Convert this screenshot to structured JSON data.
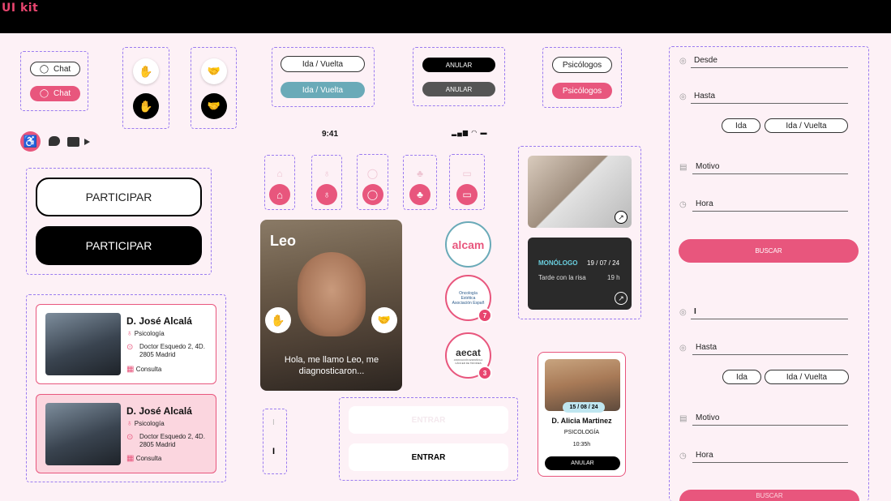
{
  "header": {
    "title": "UI kit"
  },
  "chat": {
    "label_outline": "Chat",
    "label_filled": "Chat"
  },
  "trip": {
    "label_outline": "Ida / Vuelta",
    "label_teal": "Ida / Vuelta"
  },
  "cancel": {
    "label_black": "ANULAR",
    "label_gray": "ANULAR"
  },
  "psych": {
    "label_outline": "Psicólogos",
    "label_pink": "Psicólogos"
  },
  "status_bar": {
    "time": "9:41"
  },
  "participate": {
    "label_outline": "PARTICIPAR",
    "label_black": "PARTICIPAR"
  },
  "profile_card": {
    "name": "Leo",
    "message": "Hola, me llamo Leo, me diagnosticaron..."
  },
  "doctors": [
    {
      "name": "D. José Alcalá",
      "specialty": "Psicología",
      "address_line1": "Doctor Esquedo 2, 4D.",
      "address_line2": "2805 Madrid",
      "action": "Consulta"
    },
    {
      "name": "D. José Alcalá",
      "specialty": "Psicología",
      "address_line1": "Doctor Esquedo 2, 4D.",
      "address_line2": "2805 Madrid",
      "action": "Consulta"
    }
  ],
  "associations": [
    {
      "name": "alcam",
      "badge": ""
    },
    {
      "name": "Oncología Estética Asociación Españ",
      "badge": "7"
    },
    {
      "name": "aecat",
      "subtitle": "ASOCIACIÓN ESPAÑOLA CÁNCER DE TIROIDES",
      "badge": "3"
    }
  ],
  "event": {
    "title": "MONÓLOGO",
    "date": "19 / 07 / 24",
    "subtitle": "Tarde con la risa",
    "time": "19 h"
  },
  "appointment": {
    "date": "15 / 08 / 24",
    "name": "D. Alicia Martinez",
    "specialty": "PSICOLOGÍA",
    "time": "10:35h",
    "action": "ANULAR"
  },
  "enter": {
    "label_ghost": "ENTRAR",
    "label": "ENTRAR"
  },
  "input_cursors": {
    "a": "I",
    "b": "I"
  },
  "form1": {
    "from": "Desde",
    "to": "Hasta",
    "option_one": "Ida",
    "option_round": "Ida / Vuelta",
    "reason": "Motivo",
    "time": "Hora",
    "search": "BUSCAR"
  },
  "form2": {
    "from": "I",
    "to": "Hasta",
    "option_one": "Ida",
    "option_round": "Ida / Vuelta",
    "reason": "Motivo",
    "time": "Hora",
    "search": "BUSCAR"
  },
  "colors": {
    "accent": "#e8567d",
    "teal": "#6aaab8",
    "background": "#fdf1f6",
    "dash": "#9b7cf0"
  },
  "icons": [
    "chat-icon",
    "wave-hand-icon",
    "handshake-icon",
    "accessibility-icon",
    "chat-bubble-icon",
    "video-camera-icon",
    "home-icon",
    "stethoscope-icon",
    "chat-icon",
    "park-icon",
    "car-icon",
    "location-pin-icon",
    "calendar-icon",
    "external-link-icon",
    "signal-icon",
    "wifi-icon",
    "battery-icon",
    "target-icon",
    "clock-icon",
    "note-icon"
  ]
}
